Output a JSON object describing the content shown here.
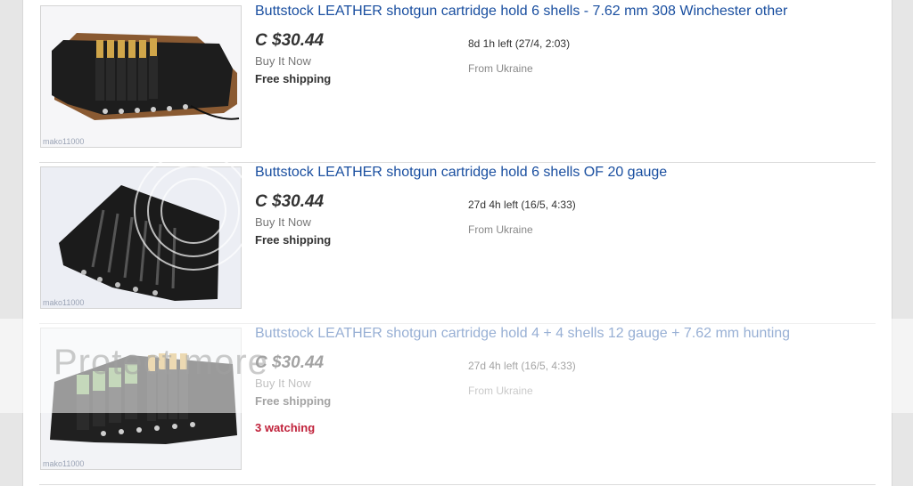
{
  "listings": [
    {
      "title": "Buttstock LEATHER shotgun cartridge hold 6 shells - 7.62 mm 308 Winchester other",
      "price": "C $30.44",
      "format": "Buy It Now",
      "shipping": "Free shipping",
      "time_left": "8d 1h left (27/4, 2:03)",
      "location": "From Ukraine",
      "watermark": "mako11000"
    },
    {
      "title": "Buttstock LEATHER shotgun cartridge hold 6 shells OF 20 gauge",
      "price": "C $30.44",
      "format": "Buy It Now",
      "shipping": "Free shipping",
      "time_left": "27d 4h left (16/5, 4:33)",
      "location": "From Ukraine",
      "watermark": "mako11000"
    },
    {
      "title": "Buttstock LEATHER shotgun cartridge hold 4 + 4 shells 12 gauge + 7.62 mm hunting",
      "price": "C $30.44",
      "format": "Buy It Now",
      "shipping": "Free shipping",
      "time_left": "27d 4h left (16/5, 4:33)",
      "location": "From Ukraine",
      "watchers": "3 watching",
      "watermark": "mako11000"
    }
  ],
  "overlay": {
    "text": "Protect more"
  },
  "colors": {
    "link": "#1a4fa0",
    "watching": "#c0213a",
    "border": "#dcdcdc"
  }
}
